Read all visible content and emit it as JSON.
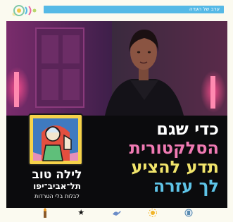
{
  "header": {
    "logo_icon": "festival-logo-icon",
    "site_link_text": "ערב של העדה",
    "link_color": "#55b9e6"
  },
  "poster": {
    "headline": {
      "line1": "כדי שגם",
      "line2": "הסלקטורית",
      "line3": "תדע להציע",
      "line4": "לך עזרה"
    },
    "festival": {
      "title": "לילה טוב",
      "city": "תל־אביב־יפו",
      "tagline": "לבלות בלי הטרדות"
    },
    "colors": {
      "pink": "#f07ab3",
      "yellow": "#f1e46b",
      "blue": "#5ec4e8"
    }
  },
  "sponsors": [
    {
      "icon": "torch-icon"
    },
    {
      "icon": "star-icon"
    },
    {
      "icon": "bird-icon"
    },
    {
      "icon": "sun-icon"
    },
    {
      "icon": "emblem-icon"
    }
  ]
}
